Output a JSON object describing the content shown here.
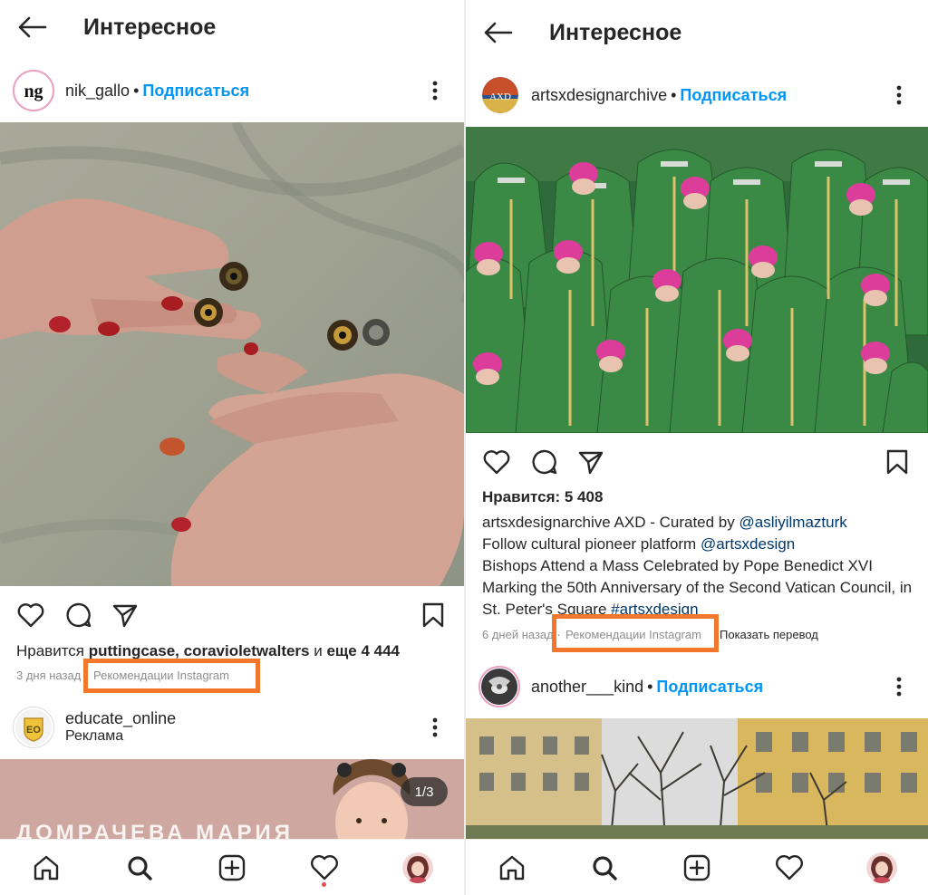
{
  "colors": {
    "accent": "#0095f6",
    "highlight": "#f2772d",
    "notification": "#ed4956"
  },
  "left": {
    "header": {
      "title": "Интересное",
      "back_icon": "arrow-left-icon"
    },
    "post1": {
      "username": "nik_gallo",
      "follow_label": "Подписаться",
      "likes_prefix": "Нравится ",
      "liked_by_1": "puttingcase",
      "liked_by_sep": ", ",
      "liked_by_2": "coravioletwalters",
      "likes_mid": " и ",
      "likes_more": "еще 4 444",
      "time": "3 дня назад",
      "meta_sep": " · ",
      "recommendation": "Рекомендации Instagram"
    },
    "post2": {
      "username": "educate_online",
      "sponsored": "Реклама",
      "carousel_counter": "1/3",
      "overlay_text": "ДОМРАЧЕВА МАРИЯ"
    }
  },
  "right": {
    "header": {
      "title": "Интересное",
      "back_icon": "arrow-left-icon"
    },
    "post1": {
      "username": "artsxdesignarchive",
      "follow_label": "Подписаться",
      "likes_label": "Нравится: 5 408",
      "caption_username": "artsxdesignarchive",
      "caption_text_1": " AXD - Curated by ",
      "caption_mention_1": "@asliyilmazturk",
      "caption_text_2": "Follow cultural pioneer platform ",
      "caption_mention_2": "@artsxdesign",
      "caption_text_3": "Bishops Attend a Mass Celebrated by Pope Benedict XVI Marking the 50th Anniversary of the Second Vatican Council, in St. Peter's Square ",
      "caption_hashtag": "#artsxdesign",
      "time": "6 дней назад",
      "meta_sep": " · ",
      "recommendation": "Рекомендации Instagram",
      "translate": "Показать перевод"
    },
    "post2": {
      "username": "another___kind",
      "follow_label": "Подписаться"
    }
  },
  "nav": {
    "items": [
      "home-icon",
      "search-icon",
      "new-post-icon",
      "activity-icon",
      "profile-avatar"
    ]
  }
}
